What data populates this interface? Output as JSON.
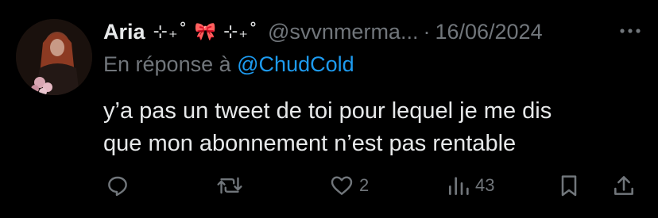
{
  "tweet": {
    "display_name": "Aria",
    "name_decoration": "⊹₊˚ 🎀 ⊹₊˚",
    "handle": "@svvnmerma...",
    "separator": "·",
    "date": "16/06/2024",
    "reply_prefix": "En réponse à",
    "reply_mention": "@ChudCold",
    "text_lines": [
      "y’a pas un tweet de toi pour lequel je me dis",
      "que mon abonnement n’est pas rentable"
    ]
  },
  "actions": {
    "likes": "2",
    "views": "43"
  },
  "icons": {
    "more": "more-horizontal-icon",
    "reply": "reply-icon",
    "retweet": "retweet-icon",
    "like": "heart-icon",
    "views": "views-icon",
    "bookmark": "bookmark-icon",
    "share": "share-icon"
  },
  "colors": {
    "background": "#000000",
    "text": "#e7e9ea",
    "secondary": "#71767b",
    "link": "#1d9bf0"
  }
}
